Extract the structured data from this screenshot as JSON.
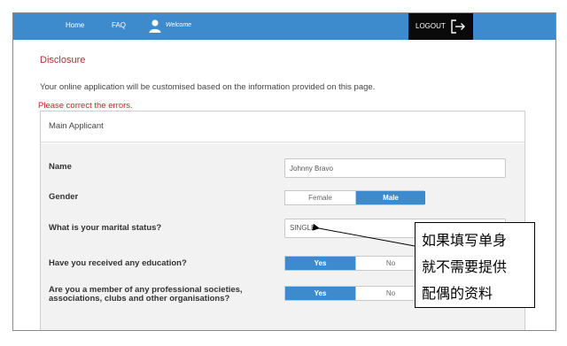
{
  "nav": {
    "home": "Home",
    "faq": "FAQ",
    "welcome": "Welcome",
    "logout": "LOGOUT"
  },
  "page": {
    "title": "Disclosure",
    "intro": "Your online application will be customised based on the information provided on this page.",
    "error": "Please correct the errors."
  },
  "panel": {
    "title": "Main Applicant",
    "name": {
      "label": "Name",
      "value": "Johnny Bravo"
    },
    "gender": {
      "label": "Gender",
      "options": [
        "Female",
        "Male"
      ],
      "selected": "Male"
    },
    "marital": {
      "label": "What is your marital status?",
      "value": "SINGLE"
    },
    "education": {
      "label": "Have you received any education?",
      "options": [
        "Yes",
        "No"
      ],
      "selected": "Yes"
    },
    "member": {
      "label_line1": "Are you a member of any professional societies,",
      "label_line2": "associations, clubs and other organisations?",
      "options": [
        "Yes",
        "No"
      ],
      "selected": "Yes"
    }
  },
  "annotation": {
    "line1": "如果填写单身",
    "line2": "就不需要提供",
    "line3": "配偶的资料"
  },
  "colors": {
    "accent": "#3d8bcd",
    "logout_bg": "#0a0a0a",
    "title_red": "#b03030",
    "error_red": "#d02020"
  }
}
